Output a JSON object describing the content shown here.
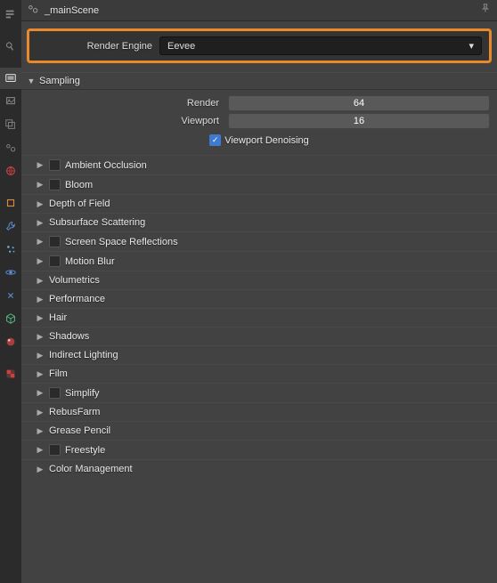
{
  "header": {
    "scene_name": "_mainScene"
  },
  "render_engine": {
    "label": "Render Engine",
    "value": "Eevee"
  },
  "sampling": {
    "title": "Sampling",
    "render_label": "Render",
    "render_value": "64",
    "viewport_label": "Viewport",
    "viewport_value": "16",
    "denoise_label": "Viewport Denoising",
    "denoise_checked": true
  },
  "panels": [
    {
      "label": "Ambient Occlusion",
      "has_checkbox": true
    },
    {
      "label": "Bloom",
      "has_checkbox": true
    },
    {
      "label": "Depth of Field",
      "has_checkbox": false
    },
    {
      "label": "Subsurface Scattering",
      "has_checkbox": false
    },
    {
      "label": "Screen Space Reflections",
      "has_checkbox": true
    },
    {
      "label": "Motion Blur",
      "has_checkbox": true
    },
    {
      "label": "Volumetrics",
      "has_checkbox": false
    },
    {
      "label": "Performance",
      "has_checkbox": false
    },
    {
      "label": "Hair",
      "has_checkbox": false
    },
    {
      "label": "Shadows",
      "has_checkbox": false
    },
    {
      "label": "Indirect Lighting",
      "has_checkbox": false
    },
    {
      "label": "Film",
      "has_checkbox": false
    },
    {
      "label": "Simplify",
      "has_checkbox": true
    },
    {
      "label": "RebusFarm",
      "has_checkbox": false
    },
    {
      "label": "Grease Pencil",
      "has_checkbox": false
    },
    {
      "label": "Freestyle",
      "has_checkbox": true
    },
    {
      "label": "Color Management",
      "has_checkbox": false
    }
  ],
  "colors": {
    "highlight": "#e88a2c",
    "checkbox": "#3f7ad0"
  }
}
